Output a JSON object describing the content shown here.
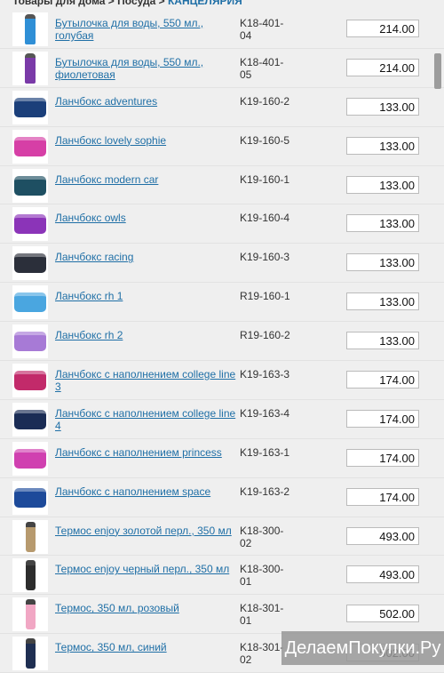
{
  "breadcrumb": {
    "path": "Товары для дома > Посуда > ",
    "current": "КАНЦЕЛЯРИЯ"
  },
  "products": [
    {
      "name": "Бутылочка для воды, 550 мл., голубая",
      "sku": "K18-401-04",
      "price": "214.00",
      "thumb": "bottle",
      "color": "#2f8fd6"
    },
    {
      "name": "Бутылочка для воды, 550 мл., фиолетовая",
      "sku": "K18-401-05",
      "price": "214.00",
      "thumb": "bottle",
      "color": "#7a3aa8"
    },
    {
      "name": "Ланчбокс adventures",
      "sku": "K19-160-2",
      "price": "133.00",
      "thumb": "box",
      "color": "#1b3f7a"
    },
    {
      "name": "Ланчбокс lovely sophie",
      "sku": "K19-160-5",
      "price": "133.00",
      "thumb": "box",
      "color": "#d63fa6"
    },
    {
      "name": "Ланчбокс modern car",
      "sku": "K19-160-1",
      "price": "133.00",
      "thumb": "box",
      "color": "#1e4f62"
    },
    {
      "name": "Ланчбокс owls",
      "sku": "K19-160-4",
      "price": "133.00",
      "thumb": "box",
      "color": "#8b34b8"
    },
    {
      "name": "Ланчбокс racing",
      "sku": "K19-160-3",
      "price": "133.00",
      "thumb": "box",
      "color": "#2b2f3a"
    },
    {
      "name": "Ланчбокс rh 1",
      "sku": "R19-160-1",
      "price": "133.00",
      "thumb": "box",
      "color": "#4aa6e0"
    },
    {
      "name": "Ланчбокс rh 2",
      "sku": "R19-160-2",
      "price": "133.00",
      "thumb": "box",
      "color": "#a77ad6"
    },
    {
      "name": "Ланчбокс с наполнением college line 3",
      "sku": "K19-163-3",
      "price": "174.00",
      "thumb": "box",
      "color": "#c22a6a"
    },
    {
      "name": "Ланчбокс с наполнением college line 4",
      "sku": "K19-163-4",
      "price": "174.00",
      "thumb": "box",
      "color": "#1a2c55"
    },
    {
      "name": "Ланчбокс с наполнением princess",
      "sku": "K19-163-1",
      "price": "174.00",
      "thumb": "box",
      "color": "#d040b0"
    },
    {
      "name": "Ланчбокс с наполнением space",
      "sku": "K19-163-2",
      "price": "174.00",
      "thumb": "box",
      "color": "#1d4a9a"
    },
    {
      "name": "Термос enjoy золотой перл., 350 мл",
      "sku": "K18-300-02",
      "price": "493.00",
      "thumb": "thermos",
      "color": "#b79a6e"
    },
    {
      "name": "Термос enjoy черный перл., 350 мл",
      "sku": "K18-300-01",
      "price": "493.00",
      "thumb": "thermos",
      "color": "#2d2d2d"
    },
    {
      "name": "Термос, 350 мл, розовый",
      "sku": "K18-301-01",
      "price": "502.00",
      "thumb": "thermos",
      "color": "#f1a7c4"
    },
    {
      "name": "Термос, 350 мл, синий",
      "sku": "K18-301-02",
      "price": "502.00",
      "thumb": "thermos",
      "color": "#1f2f52"
    }
  ],
  "watermark": "ДелаемПокупки.Ру"
}
